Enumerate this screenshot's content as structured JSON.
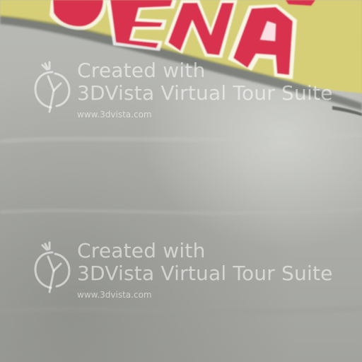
{
  "scene": {
    "description_colors": {
      "banner_yellow": "#d9d27a",
      "letter_red": "#d8324e",
      "surface_grey": "#b0b1ad"
    }
  },
  "watermarks": [
    {
      "line1": "Created with",
      "line2": "3DVista Virtual Tour Suite",
      "url": "www.3dvista.com",
      "logo_icon": "3dvista-logo-icon"
    },
    {
      "line1": "Created with",
      "line2": "3DVista Virtual Tour Suite",
      "url": "www.3dvista.com",
      "logo_icon": "3dvista-logo-icon"
    }
  ]
}
